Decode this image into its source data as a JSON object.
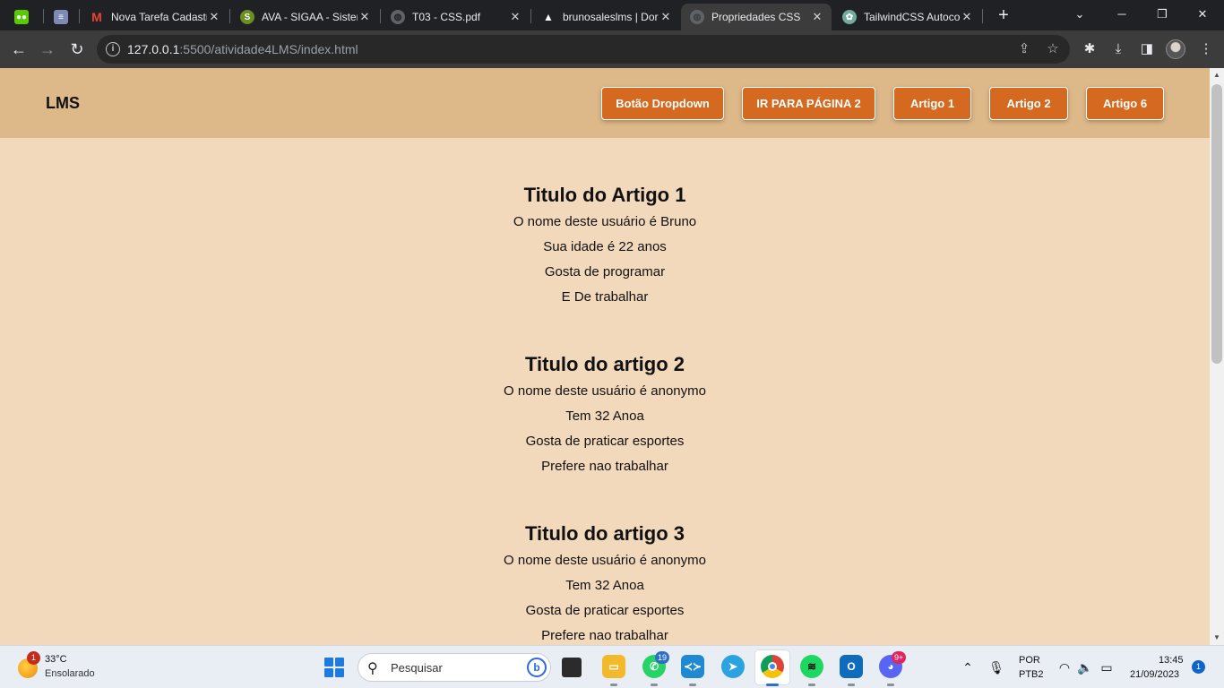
{
  "browser": {
    "tabs": [
      {
        "title": "",
        "icon": "duolingo-icon",
        "color": "#58cc02"
      },
      {
        "title": "",
        "icon": "stack-icon",
        "color": "#7e8ab3"
      },
      {
        "title": "Nova Tarefa Cadastr",
        "icon": "gmail-icon",
        "color": "#ea4335"
      },
      {
        "title": "AVA - SIGAA - Sisten",
        "icon": "sigaa-icon",
        "color": "#6b8e23"
      },
      {
        "title": "T03 - CSS.pdf",
        "icon": "pdf-icon",
        "color": "#5f6368"
      },
      {
        "title": "brunosaleslms | Dor",
        "icon": "vercel-icon",
        "color": "#ffffff"
      },
      {
        "title": "Propriedades CSS",
        "icon": "globe-icon",
        "color": "#5f6368"
      },
      {
        "title": "TailwindCSS Autoco",
        "icon": "chatgpt-icon",
        "color": "#74aa9c"
      }
    ],
    "active_tab": 6,
    "url_host": "127.0.0.1",
    "url_rest": ":5500/atividade4LMS/index.html"
  },
  "page": {
    "logo": "LMS",
    "nav_buttons": [
      "Botão Dropdown",
      "IR PARA PÁGINA 2",
      "Artigo 1",
      "Artigo 2",
      "Artigo 6"
    ],
    "articles": [
      {
        "title": "Titulo do Artigo 1",
        "lines": [
          "O nome deste usuário é Bruno",
          "Sua idade é 22 anos",
          "Gosta de programar",
          "E De trabalhar"
        ]
      },
      {
        "title": "Titulo do artigo 2",
        "lines": [
          "O nome deste usuário é anonymo",
          "Tem 32 Anoa",
          "Gosta de praticar esportes",
          "Prefere nao trabalhar"
        ]
      },
      {
        "title": "Titulo do artigo 3",
        "lines": [
          "O nome deste usuário é anonymo",
          "Tem 32 Anoa",
          "Gosta de praticar esportes",
          "Prefere nao trabalhar"
        ]
      }
    ],
    "colors": {
      "header": "#ddb889",
      "background": "#f3d9bc",
      "button": "#d4691f"
    }
  },
  "taskbar": {
    "weather_temp": "33°C",
    "weather_desc": "Ensolarado",
    "weather_badge": "1",
    "search_placeholder": "Pesquisar",
    "apps": [
      {
        "name": "file-explorer-icon",
        "badge": ""
      },
      {
        "name": "whatsapp-icon",
        "badge": "19"
      },
      {
        "name": "vscode-icon",
        "badge": ""
      },
      {
        "name": "telegram-icon",
        "badge": ""
      },
      {
        "name": "chrome-icon",
        "badge": ""
      },
      {
        "name": "spotify-icon",
        "badge": ""
      },
      {
        "name": "outlook-icon",
        "badge": ""
      },
      {
        "name": "discord-icon",
        "badge": "9+"
      }
    ],
    "lang_line1": "POR",
    "lang_line2": "PTB2",
    "time": "13:45",
    "date": "21/09/2023",
    "notifications": "1"
  }
}
